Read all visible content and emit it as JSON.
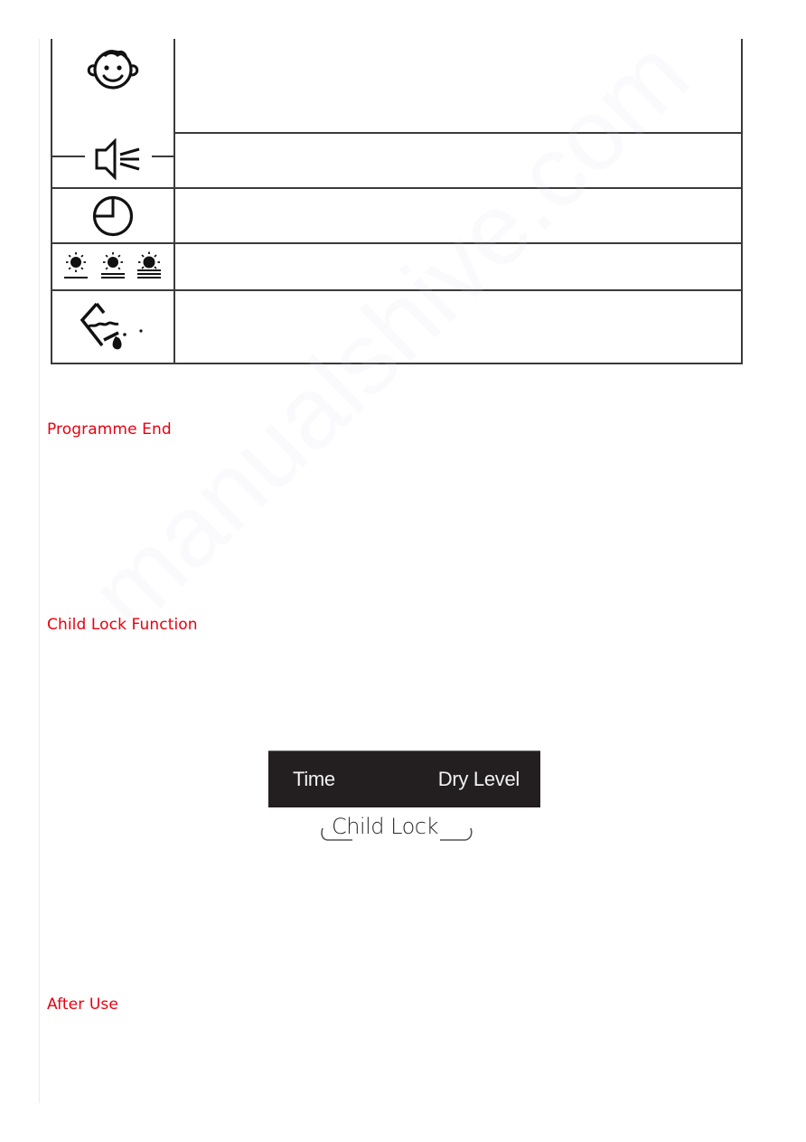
{
  "icon_table": {
    "rows": [
      {
        "icon": "child-face-icon",
        "description": ""
      },
      {
        "icon": "speaker-icon",
        "description": ""
      },
      {
        "icon": "clock-icon",
        "description": ""
      },
      {
        "icon": "dry-level-icons",
        "description": ""
      },
      {
        "icon": "water-tank-empty-icon",
        "description": ""
      }
    ]
  },
  "sections": [
    {
      "heading": "Programme End"
    },
    {
      "heading": "Child Lock Function"
    },
    {
      "heading": "After Use"
    }
  ],
  "control_panel": {
    "left_label": "Time",
    "right_label": "Dry Level",
    "combo_label": "Child Lock"
  },
  "watermark": "manualshive.com",
  "colors": {
    "heading": "#e8000f",
    "panel_background": "#231f20",
    "table_border": "#3a3a3a"
  }
}
